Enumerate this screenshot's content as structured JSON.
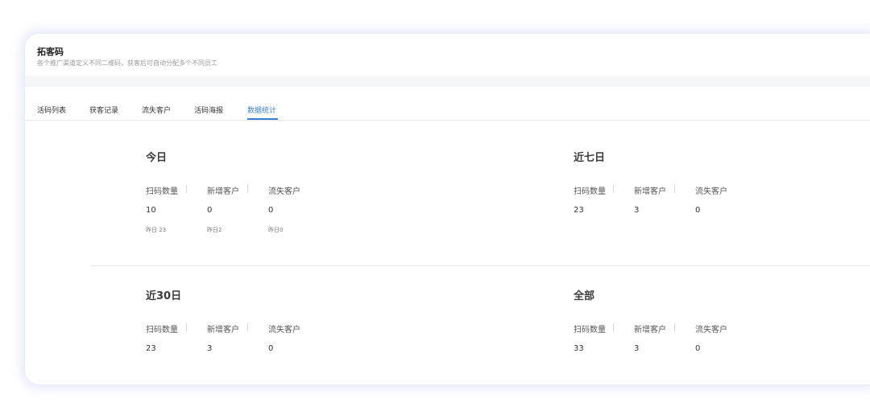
{
  "header": {
    "title": "拓客码",
    "subtitle": "各个推广渠道定义不同二维码，获客后可自动分配多个不同员工"
  },
  "tabs": [
    {
      "label": "活码列表",
      "active": false
    },
    {
      "label": "获客记录",
      "active": false
    },
    {
      "label": "流失客户",
      "active": false
    },
    {
      "label": "活码海报",
      "active": false
    },
    {
      "label": "数据统计",
      "active": true
    }
  ],
  "colors": {
    "accent": "#3a7fd5"
  },
  "stats": {
    "today": {
      "title": "今日",
      "labels": [
        "扫码数量",
        "新增客户",
        "流失客户"
      ],
      "values": [
        "10",
        "0",
        "0"
      ],
      "yesterday": [
        "昨日 23",
        "昨日2",
        "昨日0"
      ]
    },
    "week": {
      "title": "近七日",
      "labels": [
        "扫码数量",
        "新增客户",
        "流失客户"
      ],
      "values": [
        "23",
        "3",
        "0"
      ]
    },
    "month": {
      "title": "近30日",
      "labels": [
        "扫码数量",
        "新增客户",
        "流失客户"
      ],
      "values": [
        "23",
        "3",
        "0"
      ]
    },
    "all": {
      "title": "全部",
      "labels": [
        "扫码数量",
        "新增客户",
        "流失客户"
      ],
      "values": [
        "33",
        "3",
        "0"
      ]
    }
  }
}
